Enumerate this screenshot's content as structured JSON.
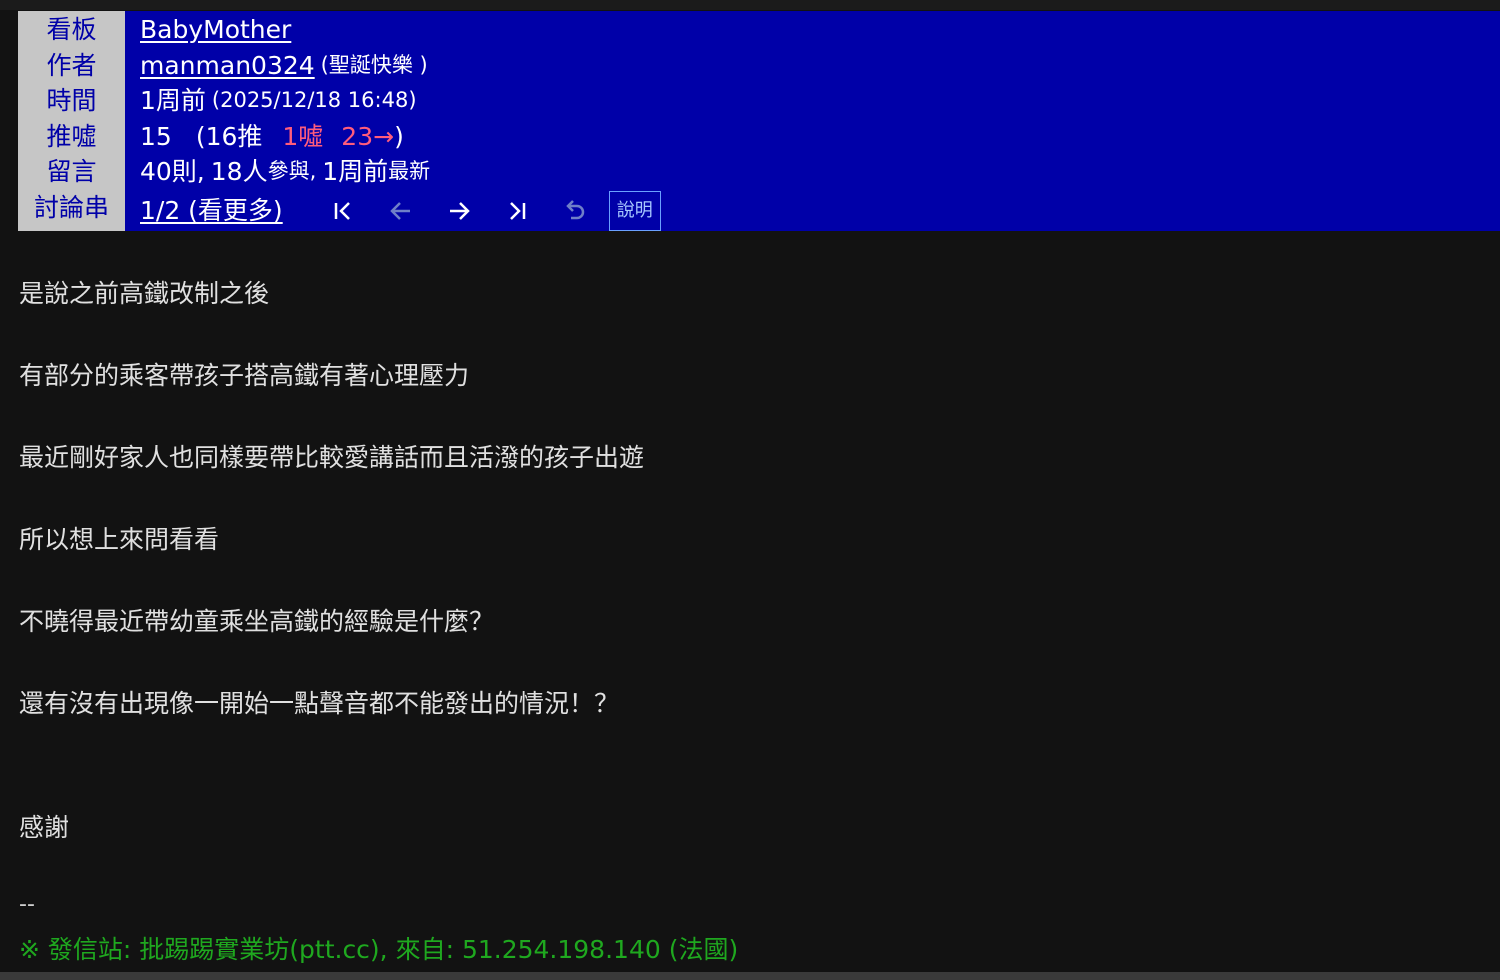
{
  "header": {
    "labels": [
      "看板",
      "作者",
      "時間",
      "推噓",
      "留言",
      "討論串"
    ],
    "board": "BabyMother",
    "author_id": "manman0324",
    "author_nick": "(聖誕快樂 )",
    "time_relative": "1周前",
    "time_absolute": "(2025/12/18 16:48)",
    "score": "15",
    "push_open": "(16推",
    "boo": "1噓",
    "arrow": "23→",
    "push_close": ")",
    "comments_count": "40則,",
    "participants_num": "18人",
    "participants_label": "參與,",
    "latest_rel": "1周前",
    "latest_label": "最新",
    "thread_page": "1/2 (看更多)",
    "help_label": "說明"
  },
  "icons": {
    "first": "first-page-icon",
    "prev": "prev-arrow-icon",
    "next": "next-arrow-icon",
    "last": "last-page-icon",
    "refresh": "undo-icon"
  },
  "body": {
    "lines": [
      "是說之前高鐵改制之後",
      "有部分的乘客帶孩子搭高鐵有著心理壓力",
      "最近剛好家人也同樣要帶比較愛講話而且活潑的孩子出遊",
      "所以想上來問看看",
      "不曉得最近帶幼童乘坐高鐵的經驗是什麼？",
      "還有沒有出現像一開始一點聲音都不能發出的情況！？",
      "感謝"
    ],
    "signature_dash": "--",
    "footer": "※ 發信站: 批踢踢實業坊(ptt.cc), 來自: 51.254.198.140 (法國)"
  },
  "colors": {
    "header_bg": "#0000a8",
    "label_bg": "#c6c6c6",
    "boo_color": "#ff5c7c",
    "footer_green": "#1fa81f"
  }
}
